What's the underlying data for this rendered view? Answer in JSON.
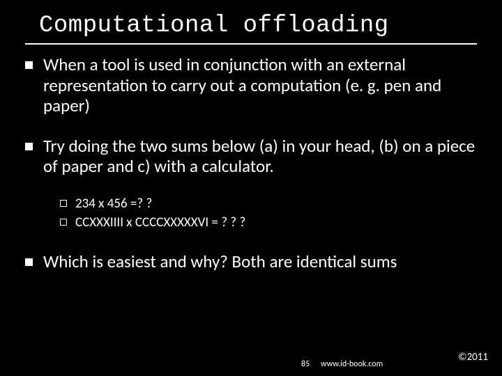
{
  "title": "Computational offloading",
  "bullets": {
    "b1": "When a tool is used in conjunction with an external representation to carry out a computation (e. g. pen and paper)",
    "b2": "Try doing the two sums below (a) in your head, (b) on a piece of paper and c) with a calculator.",
    "b3": "Which is easiest and why? Both are identical sums",
    "sub1": "234 x 456 =? ?",
    "sub2": "CCXXXIIII  x  CCCCXXXXXVI = ? ? ?"
  },
  "footer": {
    "page": "85",
    "url": "www.id-book.com",
    "copyright": "©2011"
  }
}
